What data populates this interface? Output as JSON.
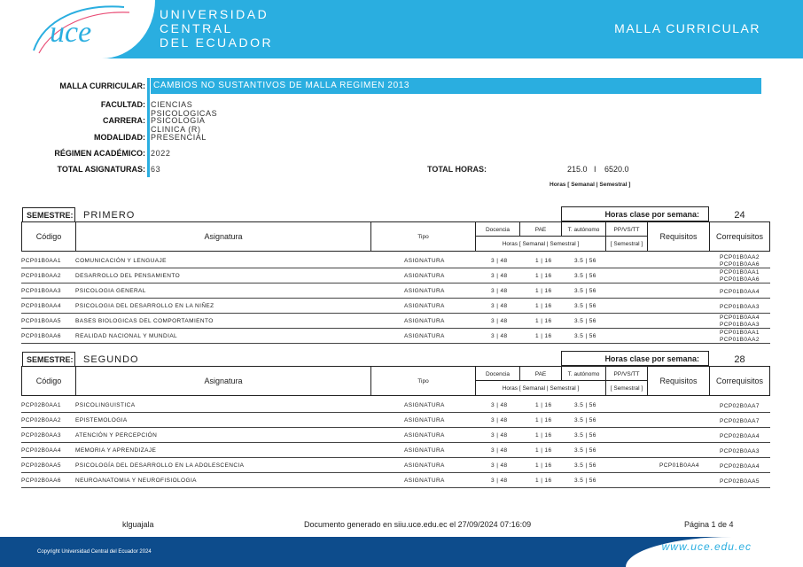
{
  "header": {
    "university_line1": "UNIVERSIDAD",
    "university_line2": "CENTRAL",
    "university_line3": "DEL ECUADOR",
    "logo_text": "uce",
    "title": "MALLA CURRICULAR",
    "colors": {
      "brand": "#2aaee0",
      "dark": "#0d4c8c"
    }
  },
  "info": {
    "malla_label": "MALLA CURRICULAR:",
    "malla_value": "CAMBIOS NO SUSTANTIVOS DE MALLA REGIMEN 2013",
    "facultad_label": "FACULTAD:",
    "facultad_value": "CIENCIAS PSICOLOGICAS",
    "carrera_label": "CARRERA:",
    "carrera_value": "PSICOLOGIA CLINICA (R)",
    "modalidad_label": "MODALIDAD:",
    "modalidad_value": "PRESENCIAL",
    "regimen_label": "RÉGIMEN ACADÉMICO:",
    "regimen_value": "2022",
    "total_asig_label": "TOTAL ASIGNATURAS:",
    "total_asig_value": "63",
    "total_horas_label": "TOTAL HORAS:",
    "total_horas_semanal": "215.0",
    "total_horas_sep": "I",
    "total_horas_semestral": "6520.0",
    "horas_note": "Horas [ Semanal | Semestral ]"
  },
  "table_headers": {
    "semestre_label": "SEMESTRE:",
    "horas_clase_label": "Horas clase por semana:",
    "codigo": "Código",
    "asignatura": "Asignatura",
    "tipo": "Tipo",
    "docencia": "Docencia",
    "pae": "PAE",
    "t_autonomo": "T. autónomo",
    "ppvstt": "PP/VS/TT",
    "horas_sem": "Horas [ Semanal | Semestral ]",
    "semestral": "[ Semestral ]",
    "requisitos": "Requisitos",
    "correquisitos": "Correquisitos"
  },
  "semesters": [
    {
      "name": "PRIMERO",
      "horas": "24",
      "rows": [
        {
          "code": "PCP01B0AA1",
          "name": "COMUNICACIÓN Y LENGUAJE",
          "tipo": "ASIGNATURA",
          "doc": "3 |   48",
          "pae": "1 |   16",
          "aut": "3.5 |   56",
          "req": "",
          "coreq": "PCP01B0AA2\nPCP01B0AA6"
        },
        {
          "code": "PCP01B0AA2",
          "name": "DESARROLLO DEL PENSAMIENTO",
          "tipo": "ASIGNATURA",
          "doc": "3 |   48",
          "pae": "1 |   16",
          "aut": "3.5 |   56",
          "req": "",
          "coreq": "PCP01B0AA1\nPCP01B0AA6"
        },
        {
          "code": "PCP01B0AA3",
          "name": "PSICOLOGIA GENERAL",
          "tipo": "ASIGNATURA",
          "doc": "3 |   48",
          "pae": "1 |   16",
          "aut": "3.5 |   56",
          "req": "",
          "coreq": "PCP01B0AA4"
        },
        {
          "code": "PCP01B0AA4",
          "name": "PSICOLOGIA DEL DESARROLLO EN LA NIÑEZ",
          "tipo": "ASIGNATURA",
          "doc": "3 |   48",
          "pae": "1 |   16",
          "aut": "3.5 |   56",
          "req": "",
          "coreq": "PCP01B0AA3"
        },
        {
          "code": "PCP01B0AA5",
          "name": "BASES BIOLOGICAS DEL COMPORTAMIENTO",
          "tipo": "ASIGNATURA",
          "doc": "3 |   48",
          "pae": "1 |   16",
          "aut": "3.5 |   56",
          "req": "",
          "coreq": "PCP01B0AA4\nPCP01B0AA3"
        },
        {
          "code": "PCP01B0AA6",
          "name": "REALIDAD NACIONAL Y MUNDIAL",
          "tipo": "ASIGNATURA",
          "doc": "3 |   48",
          "pae": "1 |   16",
          "aut": "3.5 |   56",
          "req": "",
          "coreq": "PCP01B0AA1\nPCP01B0AA2"
        }
      ]
    },
    {
      "name": "SEGUNDO",
      "horas": "28",
      "rows": [
        {
          "code": "PCP02B0AA1",
          "name": "PSICOLINGUISTICA",
          "tipo": "ASIGNATURA",
          "doc": "3 |   48",
          "pae": "1 |   16",
          "aut": "3.5 |   56",
          "req": "",
          "coreq": "PCP02B0AA7"
        },
        {
          "code": "PCP02B0AA2",
          "name": "EPISTEMOLOGIA",
          "tipo": "ASIGNATURA",
          "doc": "3 |   48",
          "pae": "1 |   16",
          "aut": "3.5 |   56",
          "req": "",
          "coreq": "PCP02B0AA7"
        },
        {
          "code": "PCP02B0AA3",
          "name": "ATENCIÓN Y PERCEPCIÓN",
          "tipo": "ASIGNATURA",
          "doc": "3 |   48",
          "pae": "1 |   16",
          "aut": "3.5 |   56",
          "req": "",
          "coreq": "PCP02B0AA4"
        },
        {
          "code": "PCP02B0AA4",
          "name": "MEMORIA Y APRENDIZAJE",
          "tipo": "ASIGNATURA",
          "doc": "3 |   48",
          "pae": "1 |   16",
          "aut": "3.5 |   56",
          "req": "",
          "coreq": "PCP02B0AA3"
        },
        {
          "code": "PCP02B0AA5",
          "name": "PSICOLOGÍA DEL DESARROLLO EN LA ADOLESCENCIA",
          "tipo": "ASIGNATURA",
          "doc": "3 |   48",
          "pae": "1 |   16",
          "aut": "3.5 |   56",
          "req": "PCP01B0AA4",
          "coreq": "PCP02B0AA4"
        },
        {
          "code": "PCP02B0AA6",
          "name": "NEUROANATOMIA Y NEUROFISIOLOGIA",
          "tipo": "ASIGNATURA",
          "doc": "3 |   48",
          "pae": "1 |   16",
          "aut": "3.5 |   56",
          "req": "",
          "coreq": "PCP02B0AA5"
        }
      ]
    }
  ],
  "footer": {
    "user": "klguajala",
    "generated": "Documento generado en siiu.uce.edu.ec el 27/09/2024 07:16:09",
    "page": "Página 1 de 4",
    "copyright": "Copyright Universidad Central del Ecuador 2024",
    "web": "www.uce.edu.ec"
  }
}
